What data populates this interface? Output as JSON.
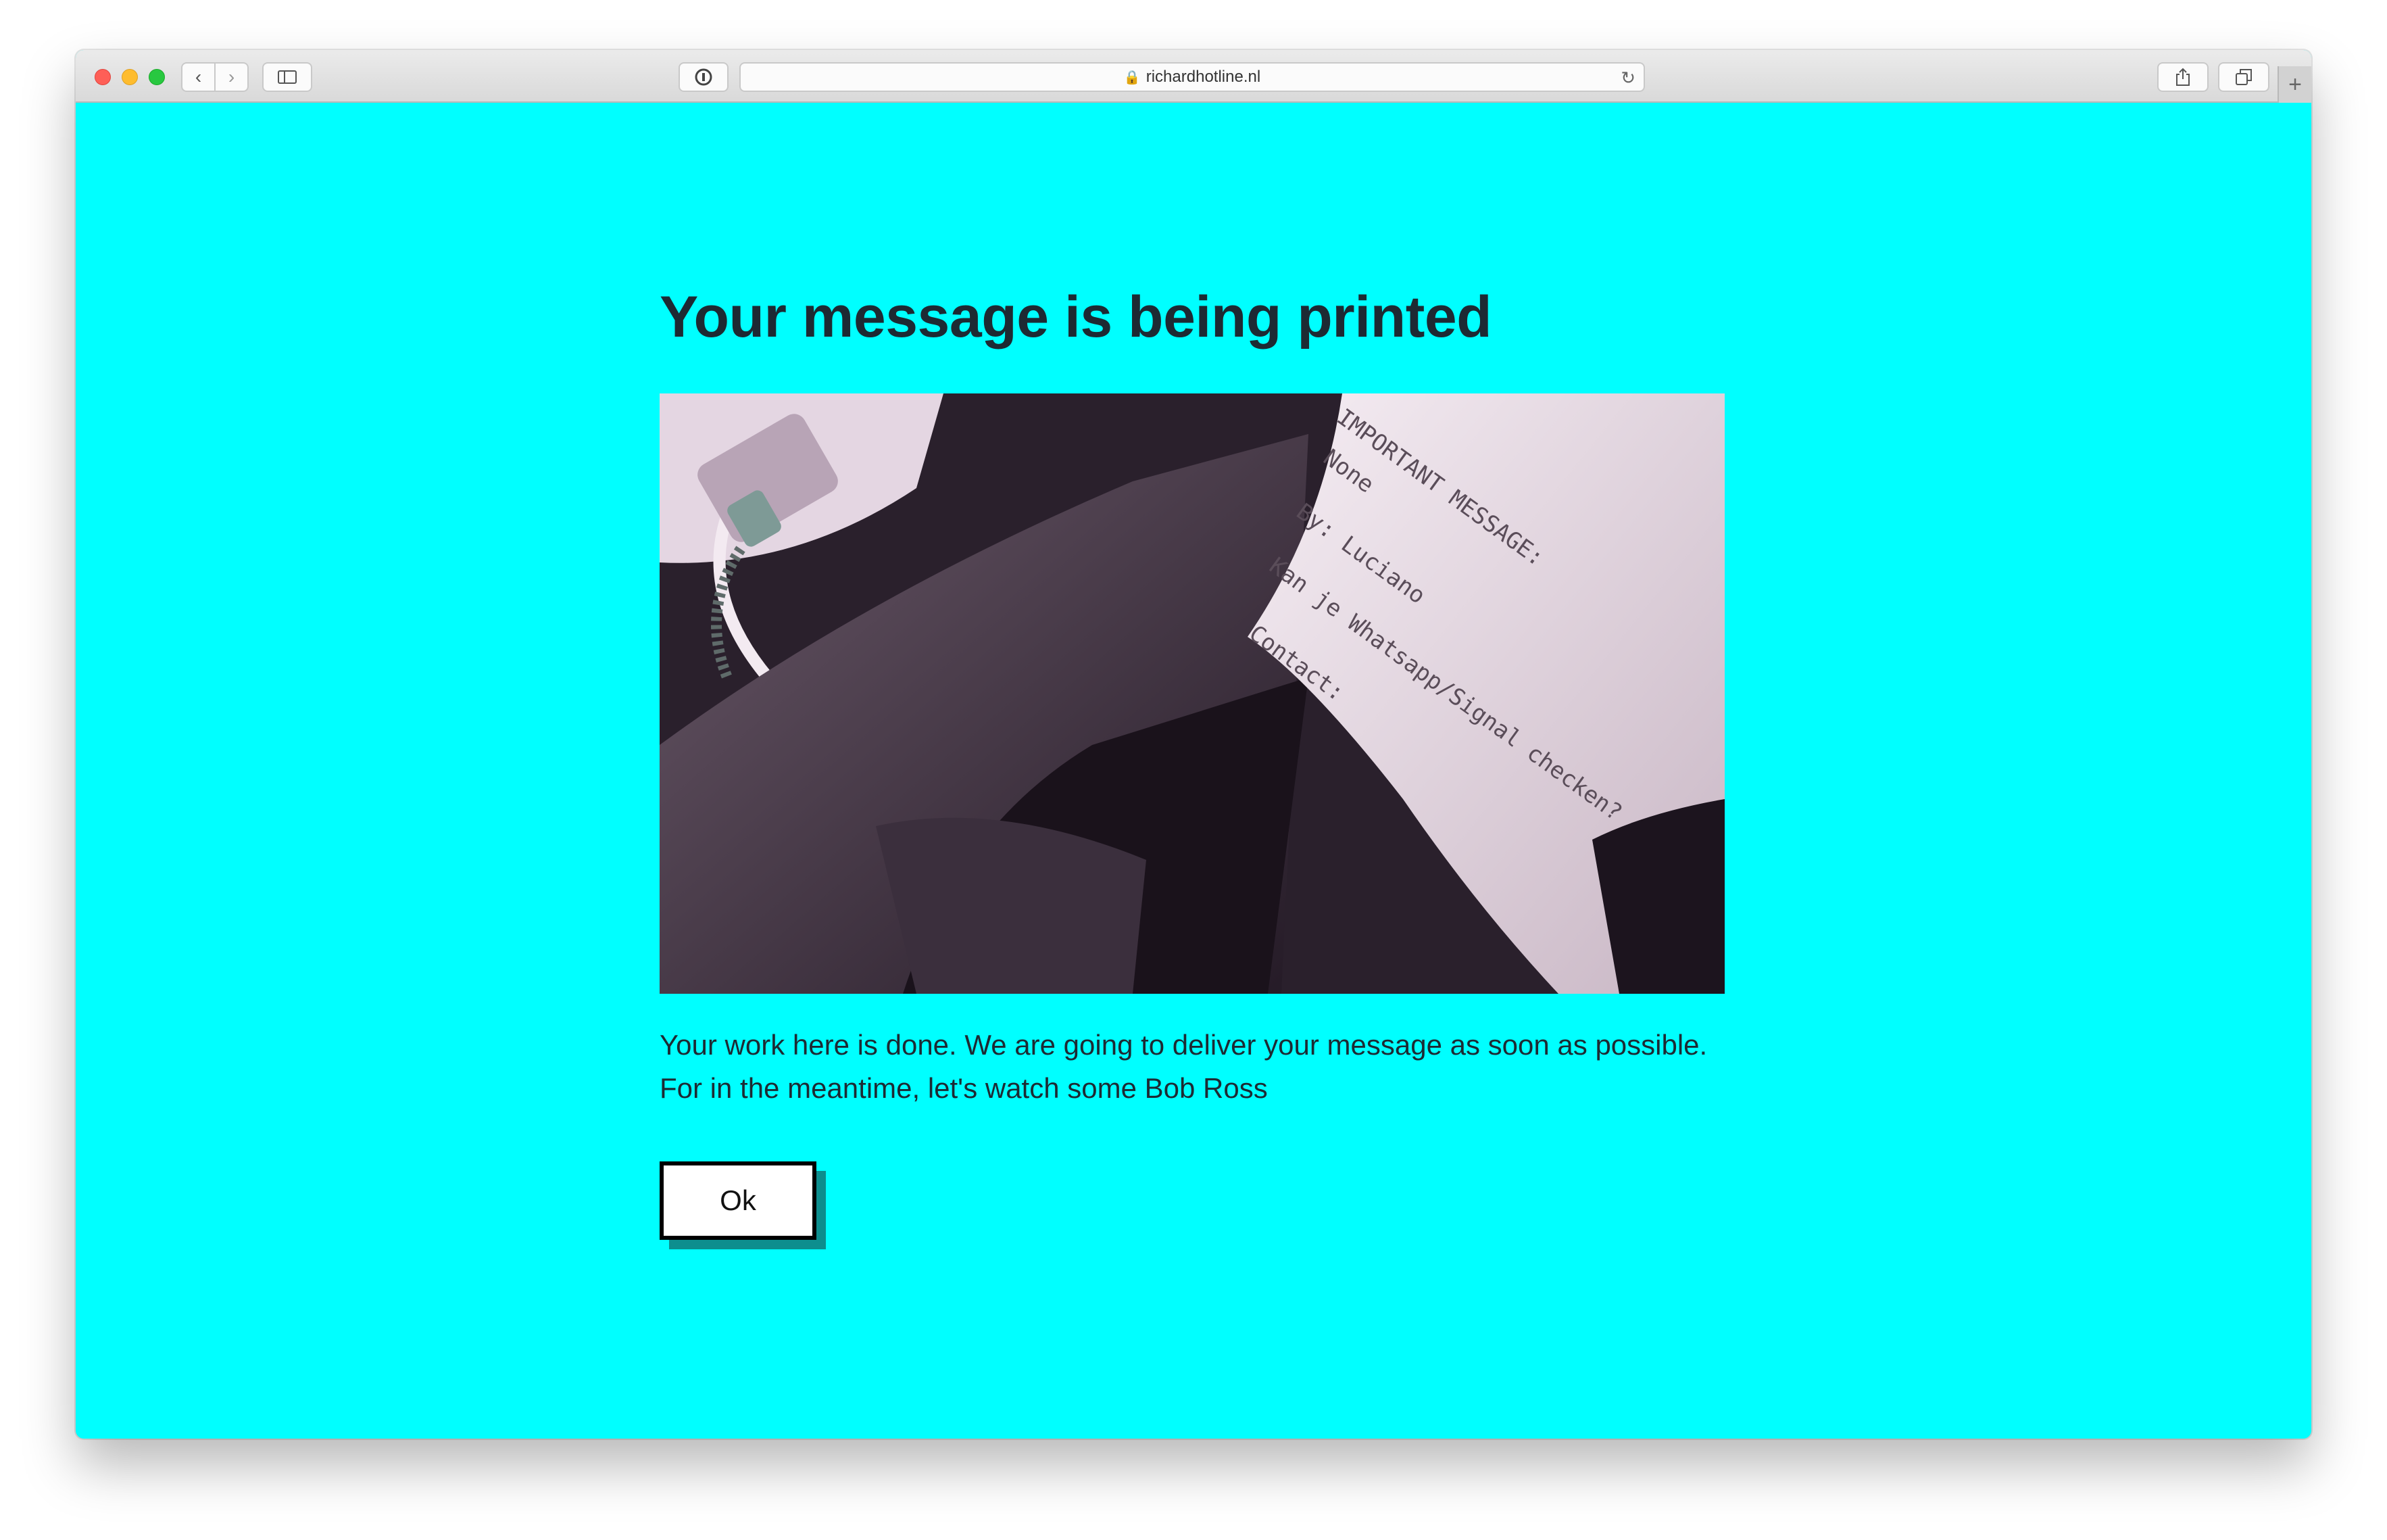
{
  "browser": {
    "url": "richardhotline.nl",
    "icons": {
      "back": "chevron-left-icon",
      "forward": "chevron-right-icon",
      "sidebar": "sidebar-icon",
      "password": "password-manager-icon",
      "lock": "lock-icon",
      "reload": "reload-icon",
      "share": "share-icon",
      "tabs": "tabs-overview-icon",
      "new_tab": "plus-icon"
    }
  },
  "page": {
    "title": "Your message is being printed",
    "body_line_1": "Your work here is done. We are going to deliver your message as soon as possible.",
    "body_line_2": "For in the meantime, let's watch some Bob Ross",
    "ok_label": "Ok",
    "background_color": "#00ffff"
  },
  "photo": {
    "receipt_lines": [
      "IMPORTANT MESSAGE:",
      "None",
      "By: Luciano",
      "Kan je Whatsapp/Signal checken?",
      "Contact:"
    ]
  }
}
